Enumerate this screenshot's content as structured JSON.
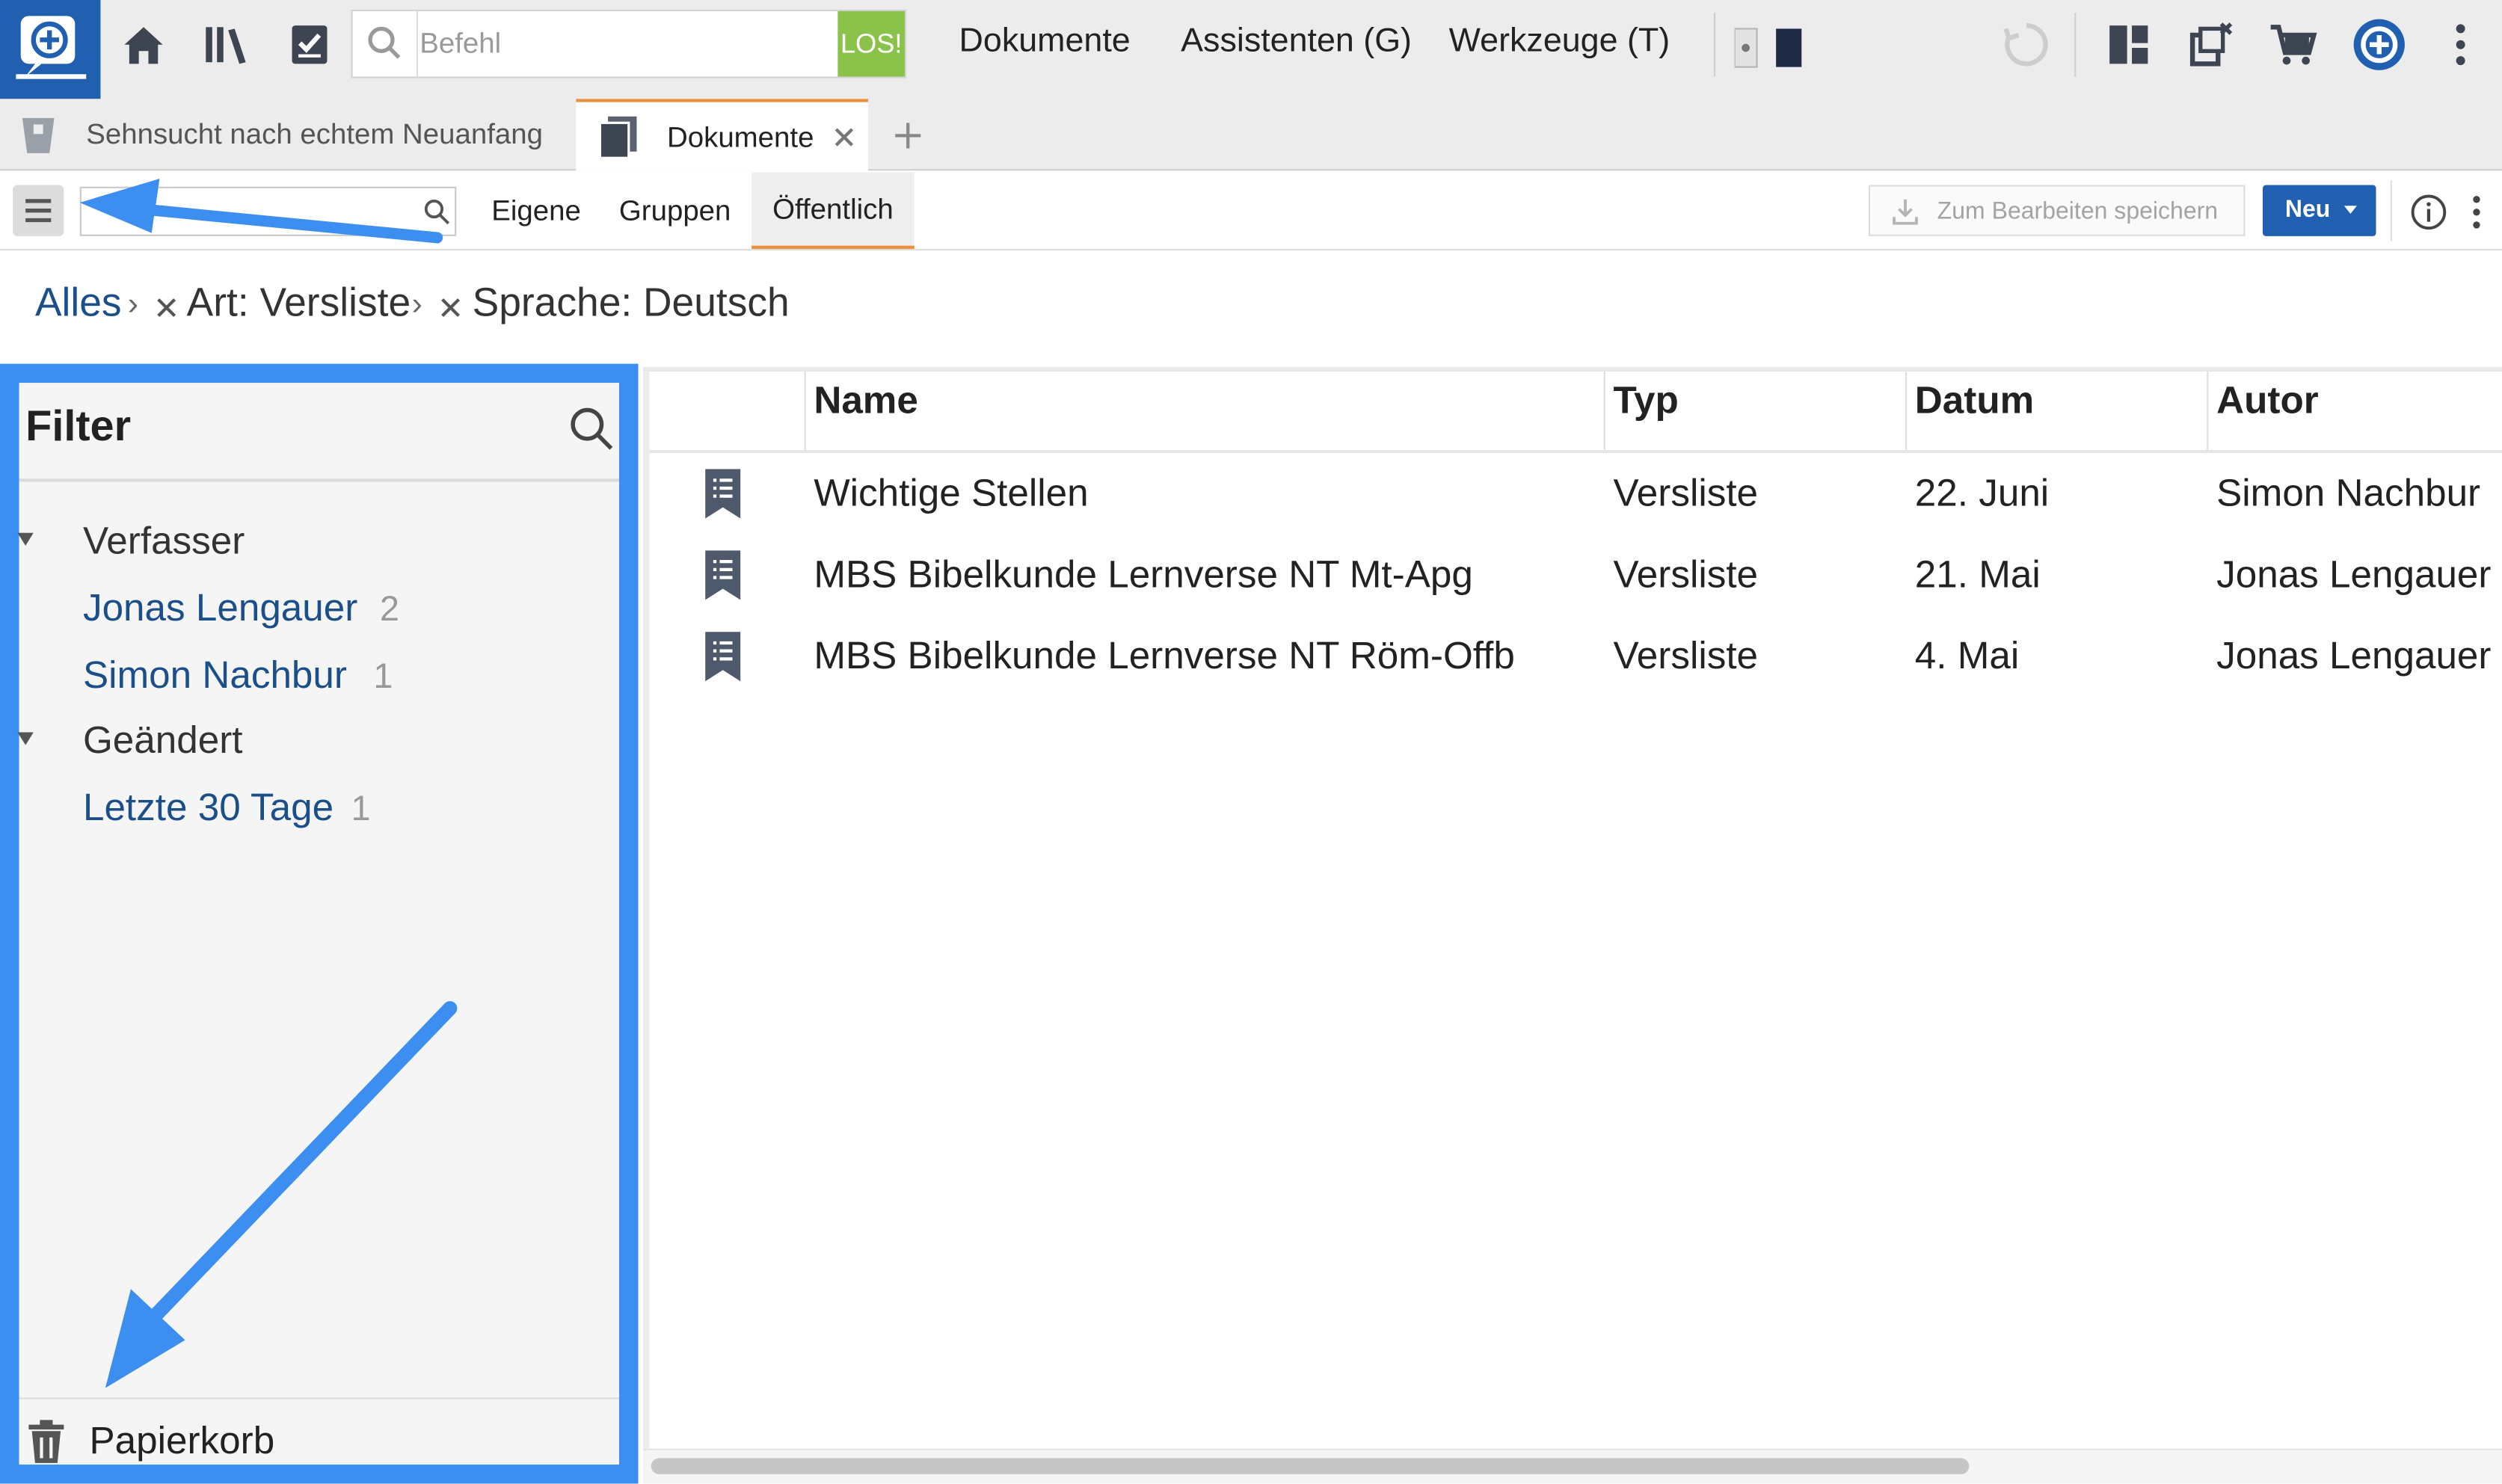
{
  "topbar": {
    "command_placeholder": "Befehl",
    "go_label": "LOS!",
    "menu": [
      "Dokumente",
      "Assistenten (G)",
      "Werkzeuge (T)"
    ]
  },
  "tabs": [
    {
      "label": "Sehnsucht nach echtem Neuanfang"
    },
    {
      "label": "Dokumente"
    }
  ],
  "toolbar": {
    "segments": [
      "Eigene",
      "Gruppen",
      "Öffentlich"
    ],
    "active_segment": "Öffentlich",
    "save_label": "Zum Bearbeiten speichern",
    "new_label": "Neu"
  },
  "breadcrumb": {
    "root": "Alles",
    "filters": [
      "Art: Versliste",
      "Sprache: Deutsch"
    ]
  },
  "filter_panel": {
    "title": "Filter",
    "groups": [
      {
        "label": "Verfasser",
        "items": [
          {
            "label": "Jonas Lengauer",
            "count": "2"
          },
          {
            "label": "Simon Nachbur",
            "count": "1"
          }
        ]
      },
      {
        "label": "Geändert",
        "items": [
          {
            "label": "Letzte 30 Tage",
            "count": "1"
          }
        ]
      }
    ],
    "trash_label": "Papierkorb"
  },
  "table": {
    "columns": [
      "Name",
      "Typ",
      "Datum",
      "Autor"
    ],
    "rows": [
      {
        "name": "Wichtige Stellen",
        "type": "Versliste",
        "date": "22. Juni",
        "author": "Simon Nachbur"
      },
      {
        "name": "MBS Bibelkunde Lernverse NT Mt-Apg",
        "type": "Versliste",
        "date": "21. Mai",
        "author": "Jonas Lengauer"
      },
      {
        "name": "MBS Bibelkunde Lernverse NT Röm-Offb",
        "type": "Versliste",
        "date": "4. Mai",
        "author": "Jonas Lengauer"
      }
    ]
  },
  "colors": {
    "brand": "#2160b0",
    "annotation": "#3c8ff0",
    "go_button": "#8bc34a",
    "tab_accent": "#e8913a",
    "link": "#1b4f8a"
  }
}
